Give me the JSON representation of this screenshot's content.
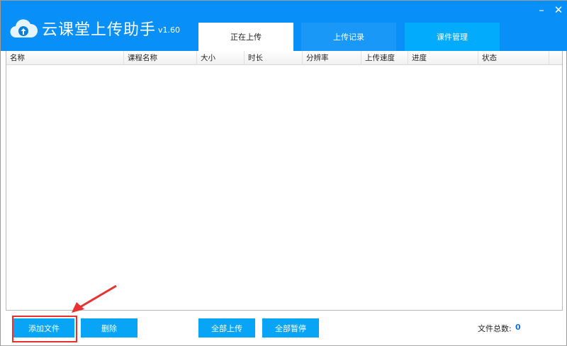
{
  "app": {
    "title": "云课堂上传助手",
    "version": "v1.60"
  },
  "tabs": [
    {
      "label": "正在上传",
      "active": true
    },
    {
      "label": "上传记录"
    },
    {
      "label": "课件管理"
    }
  ],
  "columns": [
    "名称",
    "课程名称",
    "大小",
    "时长",
    "分辨率",
    "上传速度",
    "进度",
    "状态"
  ],
  "rows": [],
  "buttons": {
    "add": "添加文件",
    "delete": "删除",
    "upload_all": "全部上传",
    "pause_all": "全部暂停"
  },
  "footer": {
    "count_label": "文件总数:",
    "count": "0"
  },
  "colors": {
    "header": "#0890f8",
    "button": "#08a4f6",
    "highlight": "#e63232"
  }
}
